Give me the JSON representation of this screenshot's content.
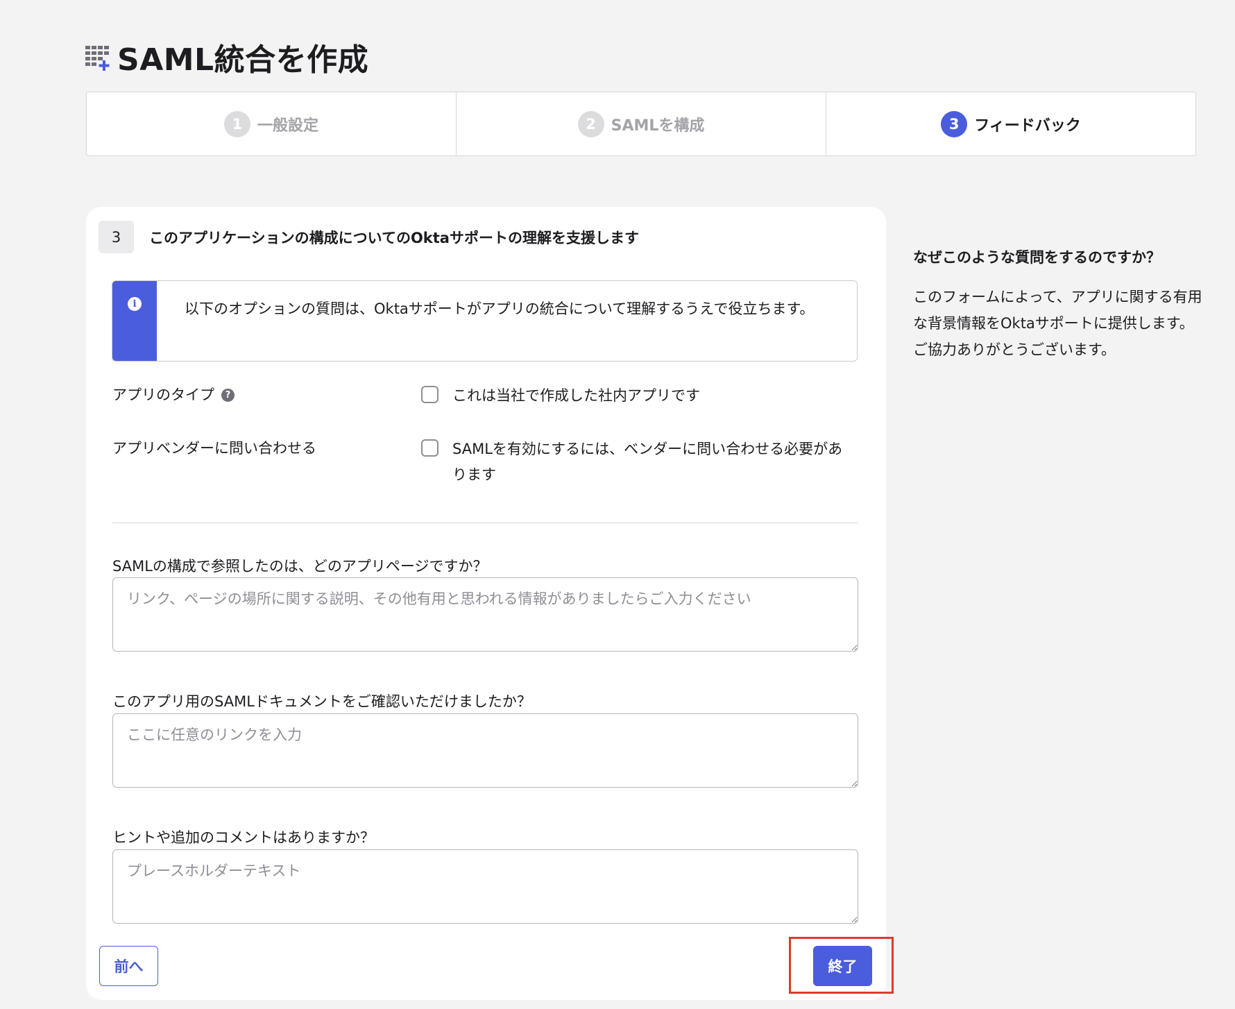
{
  "header": {
    "icon": "app-grid-add-icon",
    "title": "SAML統合を作成"
  },
  "stepper": {
    "steps": [
      {
        "number": "1",
        "label": "一般設定",
        "active": false
      },
      {
        "number": "2",
        "label": "SAMLを構成",
        "active": false
      },
      {
        "number": "3",
        "label": "フィードバック",
        "active": true
      }
    ]
  },
  "section": {
    "number": "3",
    "title": "このアプリケーションの構成についてのOktaサポートの理解を支援します"
  },
  "callout": {
    "icon": "info-icon",
    "text": "以下のオプションの質問は、Oktaサポートがアプリの統合について理解するうえで役立ちます。"
  },
  "app_type": {
    "label": "アプリのタイプ",
    "help_icon": "question-icon",
    "checkbox_label": "これは当社で作成した社内アプリです",
    "checked": false
  },
  "vendor_contact": {
    "label": "アプリベンダーに問い合わせる",
    "checkbox_label": "SAMLを有効にするには、ベンダーに問い合わせる必要があります",
    "checked": false
  },
  "questions": [
    {
      "label": "SAMLの構成で参照したのは、どのアプリページですか？",
      "placeholder": "リンク、ページの場所に関する説明、その他有用と思われる情報がありましたらご入力ください",
      "value": ""
    },
    {
      "label": "このアプリ用のSAMLドキュメントをご確認いただけましたか？",
      "placeholder": "ここに任意のリンクを入力",
      "value": ""
    },
    {
      "label": "ヒントや追加のコメントはありますか？",
      "placeholder": "プレースホルダーテキスト",
      "value": ""
    }
  ],
  "buttons": {
    "previous": "前へ",
    "finish": "終了"
  },
  "aside": {
    "title": "なぜこのような質問をするのですか？",
    "text": "このフォームによって、アプリに関する有用な背景情報をOktaサポートに提供します。ご協力ありがとうございます。"
  },
  "colors": {
    "accent": "#4a5ddd",
    "highlight": "#e0392c",
    "background": "#f3f3f3"
  }
}
